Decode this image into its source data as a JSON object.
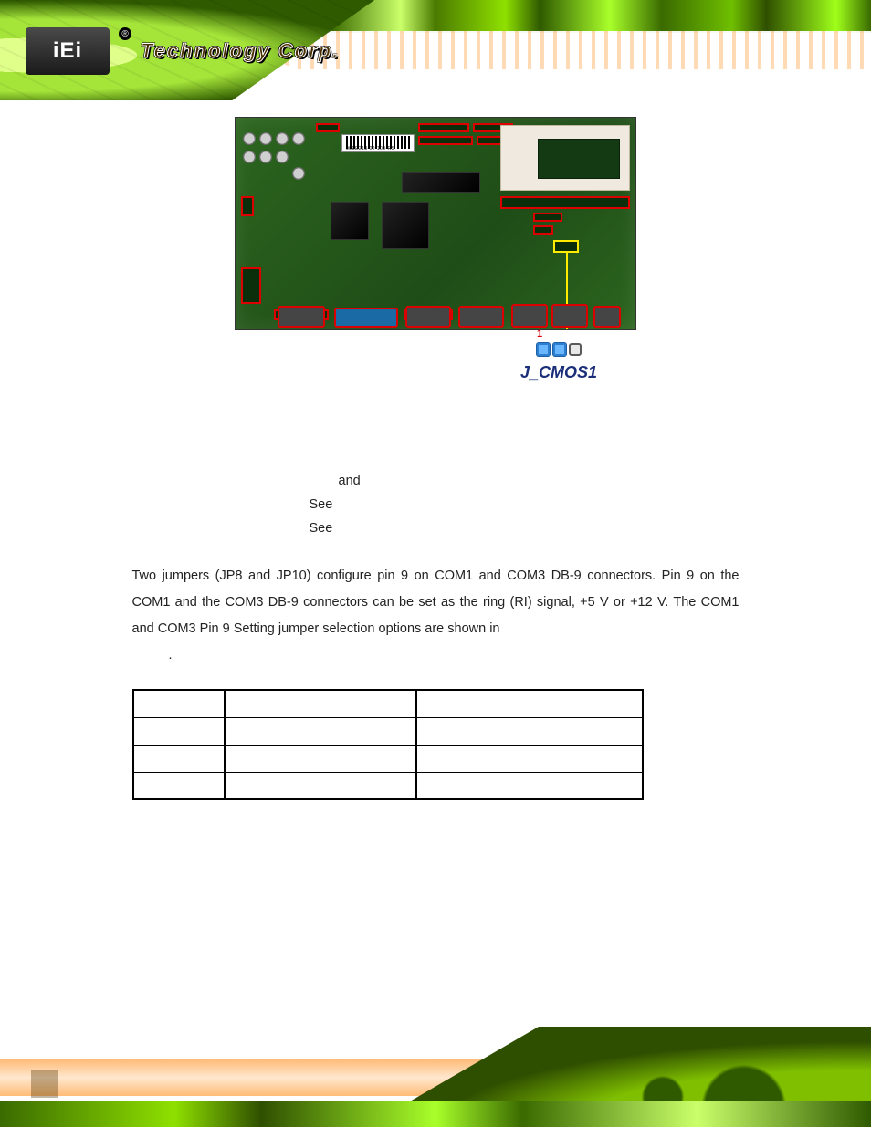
{
  "header": {
    "logo_text": "iEi",
    "logo_reg": "®",
    "brand_text": "Technology Corp."
  },
  "figure": {
    "barcode_text": "00EE218-00-100-RS",
    "callout_pin1": "1",
    "callout_label": "J_CMOS1"
  },
  "specs": {
    "row1": "and",
    "row2": "See",
    "row3": "See"
  },
  "body_text": "Two jumpers (JP8 and JP10) configure pin 9 on COM1 and COM3 DB-9 connectors. Pin 9 on the COM1 and the COM3 DB-9 connectors can be set as the ring (RI) signal, +5 V or +12 V. The COM1 and COM3 Pin 9 Setting jumper selection options are shown in",
  "body_text_tail": ".",
  "table": {
    "rows": [
      [
        "",
        "",
        ""
      ],
      [
        "",
        "",
        ""
      ],
      [
        "",
        "",
        ""
      ],
      [
        "",
        "",
        ""
      ]
    ]
  },
  "chart_data": {
    "type": "table",
    "title": "COM1 and COM3 Pin 9 Setting jumper selection options",
    "note": "Cells are blank in the source image; structure is 4 rows × 3 columns",
    "columns": [
      "",
      "",
      ""
    ],
    "rows": [
      [
        "",
        "",
        ""
      ],
      [
        "",
        "",
        ""
      ],
      [
        "",
        "",
        ""
      ],
      [
        "",
        "",
        ""
      ]
    ]
  }
}
